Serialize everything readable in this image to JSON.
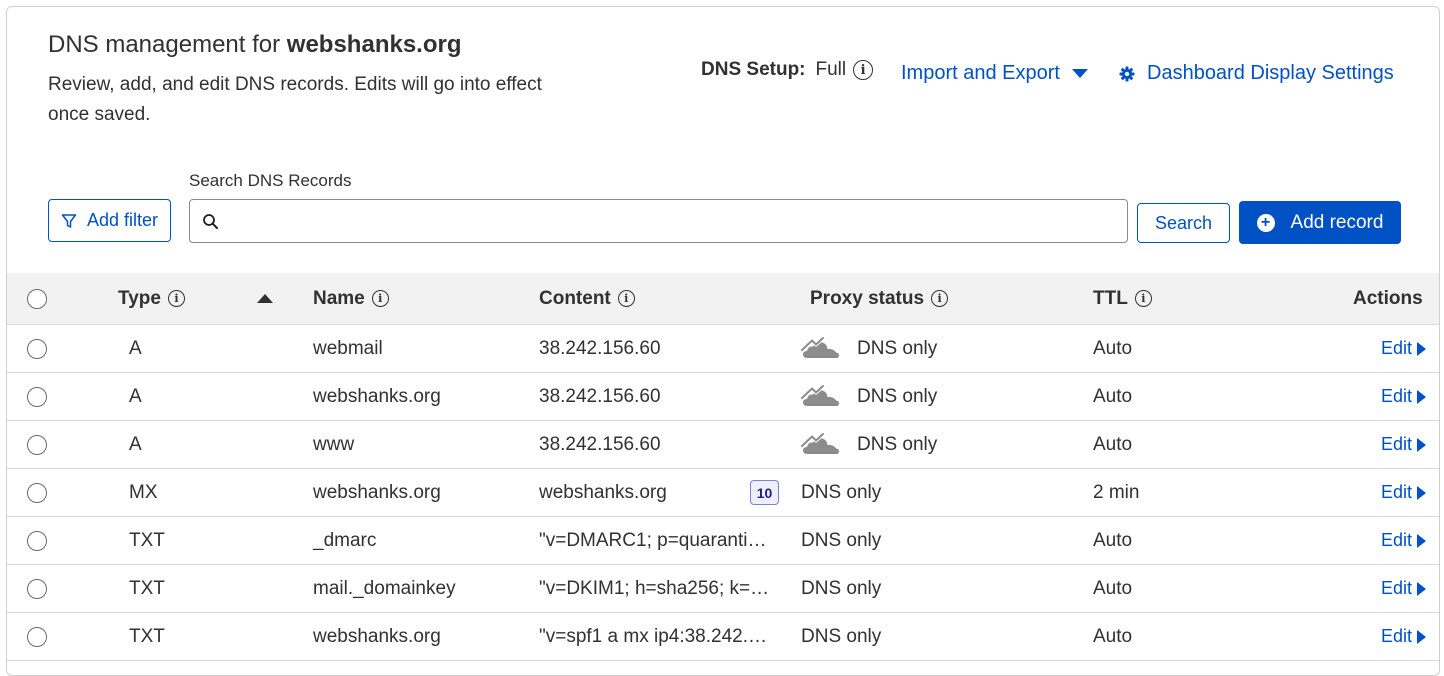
{
  "header": {
    "title_prefix": "DNS management for ",
    "title_domain": "webshanks.org",
    "description": "Review, add, and edit DNS records. Edits will go into effect once saved.",
    "dns_setup_label": "DNS Setup:",
    "dns_setup_value": "Full",
    "import_export_label": "Import and Export",
    "dashboard_settings_label": "Dashboard Display Settings"
  },
  "toolbar": {
    "add_filter_label": "Add filter",
    "search_label": "Search DNS Records",
    "search_placeholder": "",
    "search_button_label": "Search",
    "add_record_label": "Add record"
  },
  "table": {
    "columns": {
      "type": "Type",
      "name": "Name",
      "content": "Content",
      "proxy_status": "Proxy status",
      "ttl": "TTL",
      "actions": "Actions"
    },
    "sort": "Type ascending",
    "rows": [
      {
        "type": "A",
        "name": "webmail",
        "content": "38.242.156.60",
        "priority": "",
        "proxy": "DNS only",
        "proxy_icon": "cloud-dns-only-icon",
        "ttl": "Auto",
        "action": "Edit"
      },
      {
        "type": "A",
        "name": "webshanks.org",
        "content": "38.242.156.60",
        "priority": "",
        "proxy": "DNS only",
        "proxy_icon": "cloud-dns-only-icon",
        "ttl": "Auto",
        "action": "Edit"
      },
      {
        "type": "A",
        "name": "www",
        "content": "38.242.156.60",
        "priority": "",
        "proxy": "DNS only",
        "proxy_icon": "cloud-dns-only-icon",
        "ttl": "Auto",
        "action": "Edit"
      },
      {
        "type": "MX",
        "name": "webshanks.org",
        "content": "webshanks.org",
        "priority": "10",
        "proxy": "DNS only",
        "proxy_icon": "",
        "ttl": "2 min",
        "action": "Edit"
      },
      {
        "type": "TXT",
        "name": "_dmarc",
        "content": "\"v=DMARC1; p=quaranti…",
        "priority": "",
        "proxy": "DNS only",
        "proxy_icon": "",
        "ttl": "Auto",
        "action": "Edit"
      },
      {
        "type": "TXT",
        "name": "mail._domainkey",
        "content": "\"v=DKIM1; h=sha256; k=…",
        "priority": "",
        "proxy": "DNS only",
        "proxy_icon": "",
        "ttl": "Auto",
        "action": "Edit"
      },
      {
        "type": "TXT",
        "name": "webshanks.org",
        "content": "\"v=spf1 a mx ip4:38.242.…",
        "priority": "",
        "proxy": "DNS only",
        "proxy_icon": "",
        "ttl": "Auto",
        "action": "Edit"
      }
    ]
  },
  "colors": {
    "accent": "#0051c3",
    "text": "#313131",
    "header_bg": "#f2f2f2",
    "border": "#d9d9d9",
    "cloud_gray": "#8c8c8c"
  }
}
